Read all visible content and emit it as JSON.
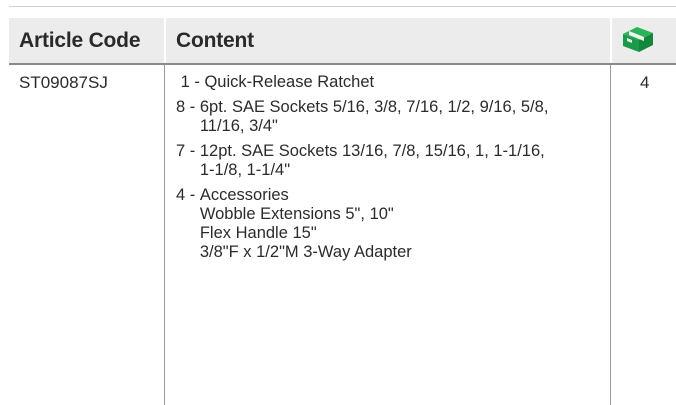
{
  "table": {
    "headers": {
      "article_code": "Article Code",
      "content": "Content",
      "quantity_icon": "box-icon"
    },
    "rows": [
      {
        "article_code": "ST09087SJ",
        "quantity": "4",
        "content": [
          {
            "qty": " 1 - ",
            "lines": [
              "Quick-Release Ratchet"
            ]
          },
          {
            "qty": "8 - ",
            "lines": [
              "6pt. SAE Sockets 5/16, 3/8, 7/16, 1/2, 9/16, 5/8,",
              "11/16, 3/4\""
            ]
          },
          {
            "qty": "7 - ",
            "lines": [
              "12pt. SAE Sockets 13/16, 7/8, 15/16, 1, 1-1/16,",
              "1-1/8, 1-1/4\""
            ]
          },
          {
            "qty": "4 - ",
            "lines": [
              "Accessories",
              "Wobble Extensions 5\", 10\"",
              "Flex Handle 15\"",
              "3/8\"F x 1/2\"M 3-Way Adapter"
            ]
          }
        ]
      }
    ]
  },
  "colors": {
    "header_bg": "#ececec",
    "brand_green": "#1a9a4a",
    "text": "#2b2b2b"
  }
}
